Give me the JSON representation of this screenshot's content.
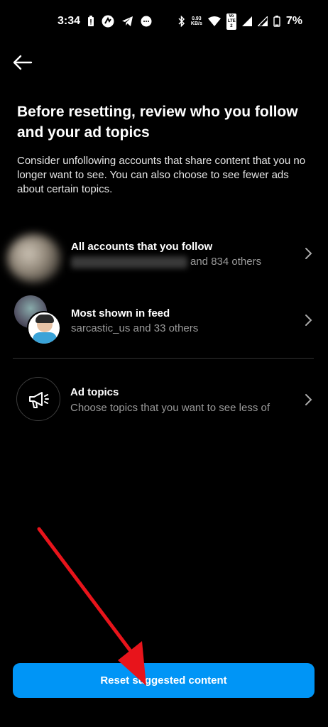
{
  "status_bar": {
    "time": "3:34",
    "net_speed_value": "0.93",
    "net_speed_unit": "KB/s",
    "volte_badge": "Vo LTE 2",
    "battery_pct": "7%"
  },
  "page": {
    "title": "Before resetting, review who you follow and your ad topics",
    "description": "Consider unfollowing accounts that share content that you no longer want to see. You can also choose to see fewer ads about certain topics."
  },
  "rows": {
    "accounts": {
      "label": "All accounts that you follow",
      "sub": "and 834 others"
    },
    "feed": {
      "label": "Most shown in feed",
      "sub": "sarcastic_us and 33 others"
    },
    "ads": {
      "label": "Ad topics",
      "sub": "Choose topics that you want to see less of"
    }
  },
  "reset_button": {
    "label": "Reset suggested content"
  },
  "colors": {
    "accent": "#0095f6",
    "annotation": "#e8141b"
  },
  "icons": [
    "back-arrow-icon",
    "chevron-right-icon",
    "megaphone-icon"
  ]
}
